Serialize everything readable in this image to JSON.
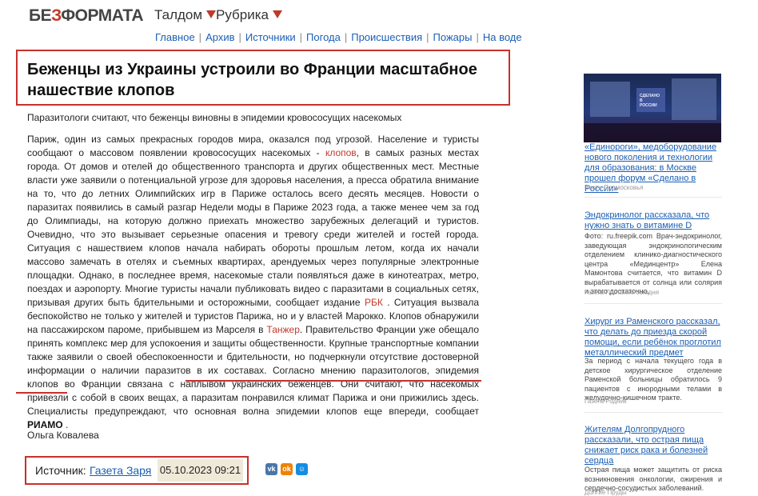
{
  "header": {
    "logo_part1": "БЕ",
    "logo_part2": "З",
    "logo_part3": "ФОРМАТА",
    "city": "Талдом",
    "rubric": "Рубрика"
  },
  "nav": [
    "Главное",
    "Архив",
    "Источники",
    "Погода",
    "Происшествия",
    "Пожары",
    "На воде"
  ],
  "article": {
    "title": "Беженцы из Украины устроили во Франции масштабное нашествие клопов",
    "subtitle": "Паразитологи считают, что беженцы виновны в эпидемии кровососущих насекомых",
    "p1": "Париж, один из самых прекрасных городов мира, оказался под угрозой. Население и туристы сообщают о массовом появлении кровососущих насекомых - ",
    "link1": "клопов",
    "p2": ", в самых разных местах города. От домов и отелей до общественного транспорта и других общественных мест. Местные власти уже заявили о потенциальной угрозе для здоровья населения, а пресса обратила внимание на то, что до летних Олимпийских игр в Париже осталось всего десять месяцев. Новости о паразитах появились в самый разгар Недели моды в Париже 2023 года, а также менее чем за год до Олимпиады, на которую должно приехать множество зарубежных делегаций и туристов. Очевидно, что это вызывает серьезные опасения и тревогу среди жителей и гостей города. Ситуация с нашествием клопов начала набирать обороты прошлым летом, когда их начали массово замечать в отелях и съемных квартирах, арендуемых через популярные электронные площадки. Однако, в последнее время, насекомые стали появляться даже в кинотеатрах, метро, поездах и аэропорту. Многие туристы начали публиковать видео с паразитами в социальных сетях, призывая других быть бдительными и осторожными, сообщает издание ",
    "link2": "РБК",
    "p3": " . Ситуация вызвала беспокойство не только у жителей и туристов Парижа, но и у властей Марокко. Клопов обнаружили на пассажирском пароме, прибывшем из Марселя в ",
    "link3": "Танжер",
    "p4": ". Правительство Франции уже обещало принять комплекс мер для успокоения и защиты общественности. Крупные транспортные компании также заявили о своей обеспокоенности и бдительности, но подчеркнули отсутствие достоверной информации о наличии паразитов в их составах. Согласно мнению паразитологов, эпидемия клопов во Франции связана с наплывом украинских беженцев. Они считают, что насекомых привезли с собой в своих вещах, а паразитам понравился климат Парижа и они прижились здесь. Специалисты предупреждают, что основная волна эпидемии клопов еще впереди, сообщает ",
    "bold1": "РИАМО",
    "p5": " .",
    "author": "Ольга Ковалева",
    "source_label": "Источник:",
    "source_name": "Газета Заря",
    "date": "05.10.2023 09:21"
  },
  "share": {
    "vk": "vk",
    "ok": "ok",
    "mm": "☺"
  },
  "sidebar": {
    "image_text": "СДЕЛАНО В РОССИИ",
    "items": [
      {
        "title": "«Единороги», медоборудование нового поколения и технологии для образования: в Москве прошел форум «Сделано в России»",
        "source": "Вести Подмосковья"
      },
      {
        "title": "Эндокринолог рассказала, что нужно знать о витамине D",
        "text": "Фото: ru.freepik.com Врач-эндокринолог, заведующая эндокринологическим отделением клинико-диагностического центра «Мединцентр» Елена Мамонтова считается, что витамин D вырабатывается от солнца или солярия и этого достаточно.",
        "source": "Газета Протвино сегодня"
      },
      {
        "title": "Хирург из Раменского рассказал, что делать до приезда скорой помощи, если ребёнок проглотил металлический предмет",
        "text": "За период с начала текущего года в детское хирургическое отделение Раменской больницы обратилось 9 пациентов с инородными телами в желудочно-кишечном тракте.",
        "source": "Газета Родник"
      },
      {
        "title": "Жителям Долгопрудного рассказали, что острая пища снижает риск рака и болезней сердца",
        "text": "Острая пища может защитить от риска возникновения онкологии, ожирения и сердечно-сосудистых заболеваний.",
        "source": "Долгие Пруды"
      }
    ]
  }
}
